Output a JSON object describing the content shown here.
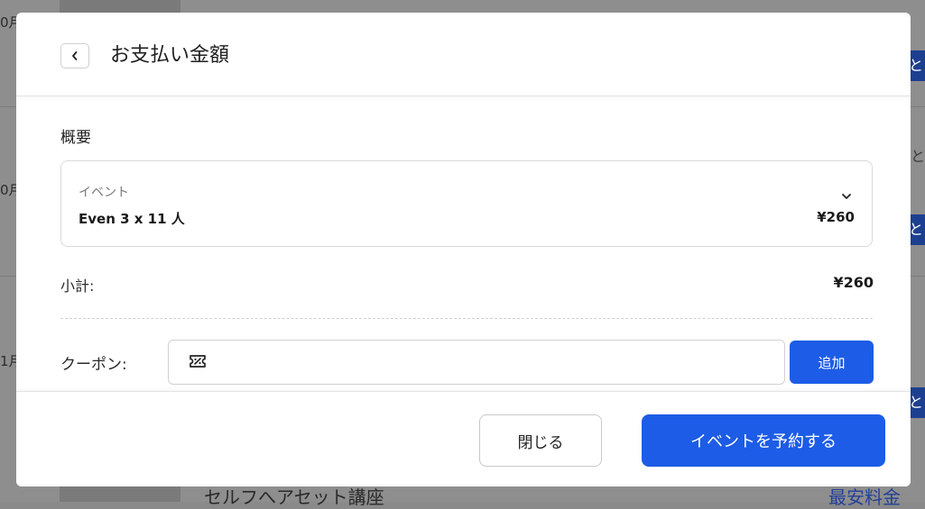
{
  "background": {
    "dates": [
      "0月",
      "0月",
      "1月"
    ],
    "side_chars": [
      "と",
      "と",
      "と",
      "と"
    ],
    "bottom_title": "セルフへアセット講座",
    "bottom_price": "最安料金"
  },
  "modal": {
    "title": "お支払い金額",
    "back_icon": "chevron-left-icon",
    "summary_label": "概要",
    "event": {
      "category": "イベント",
      "name": "Even 3 x 11 人",
      "price": "¥260",
      "expand_icon": "chevron-down-icon"
    },
    "subtotal_label": "小計:",
    "subtotal_value": "¥260",
    "coupon": {
      "label": "クーポン:",
      "value": "",
      "placeholder": "",
      "icon": "coupon-ticket-icon",
      "add_label": "追加"
    },
    "footer": {
      "close_label": "閉じる",
      "book_label": "イベントを予約する"
    }
  },
  "colors": {
    "primary": "#1d5ce6",
    "overlay": "#8e8e8e"
  }
}
